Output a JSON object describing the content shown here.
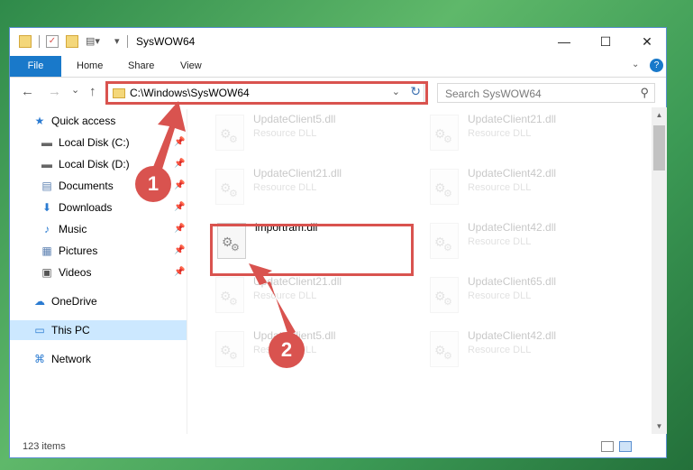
{
  "window": {
    "title": "SysWOW64"
  },
  "controls": {
    "minimize": "—",
    "maximize": "☐",
    "close": "✕"
  },
  "ribbon": {
    "tabs": [
      "File",
      "Home",
      "Share",
      "View"
    ]
  },
  "nav": {
    "back": "←",
    "forward": "→",
    "recent": "⌄",
    "up": "↑",
    "address": "C:\\Windows\\SysWOW64",
    "dropdown": "⌄",
    "refresh": "↻",
    "search_placeholder": "Search SysWOW64",
    "search_icon": "⚲"
  },
  "sidebar": {
    "items": [
      {
        "label": "Quick access",
        "icon": "star-icon",
        "glyph": "★"
      },
      {
        "label": "Local Disk (C:)",
        "icon": "drive-icon",
        "glyph": "▬",
        "pin": "📌"
      },
      {
        "label": "Local Disk (D:)",
        "icon": "drive-icon",
        "glyph": "▬",
        "pin": "📌"
      },
      {
        "label": "Documents",
        "icon": "documents-icon",
        "glyph": "▤",
        "pin": "📌"
      },
      {
        "label": "Downloads",
        "icon": "download-icon",
        "glyph": "⬇",
        "pin": "📌"
      },
      {
        "label": "Music",
        "icon": "music-icon",
        "glyph": "♪",
        "pin": "📌"
      },
      {
        "label": "Pictures",
        "icon": "pictures-icon",
        "glyph": "▦",
        "pin": "📌"
      },
      {
        "label": "Videos",
        "icon": "videos-icon",
        "glyph": "▣",
        "pin": "📌"
      },
      {
        "label": "OneDrive",
        "icon": "cloud-icon",
        "glyph": "☁"
      },
      {
        "label": "This PC",
        "icon": "computer-icon",
        "glyph": "▭"
      },
      {
        "label": "Network",
        "icon": "network-icon",
        "glyph": "⌘"
      }
    ]
  },
  "files": [
    {
      "name": "UpdateClient5.dll",
      "type": "Resource DLL"
    },
    {
      "name": "UpdateClient21.dll",
      "type": "Resource DLL"
    },
    {
      "name": "UpdateClient21.dll",
      "type": "Resource DLL"
    },
    {
      "name": "UpdateClient42.dll",
      "type": "Resource DLL"
    },
    {
      "name": "importram.dll",
      "type": ""
    },
    {
      "name": "UpdateClient42.dll",
      "type": "Resource DLL"
    },
    {
      "name": "UpdateClient21.dll",
      "type": "Resource DLL"
    },
    {
      "name": "UpdateClient65.dll",
      "type": "Resource DLL"
    },
    {
      "name": "UpdateClient5.dll",
      "type": "Resource DLL"
    },
    {
      "name": "UpdateClient42.dll",
      "type": "Resource DLL"
    }
  ],
  "status": {
    "count": "123 items"
  },
  "annotations": {
    "step1": "1",
    "step2": "2",
    "color": "#d9534f"
  }
}
